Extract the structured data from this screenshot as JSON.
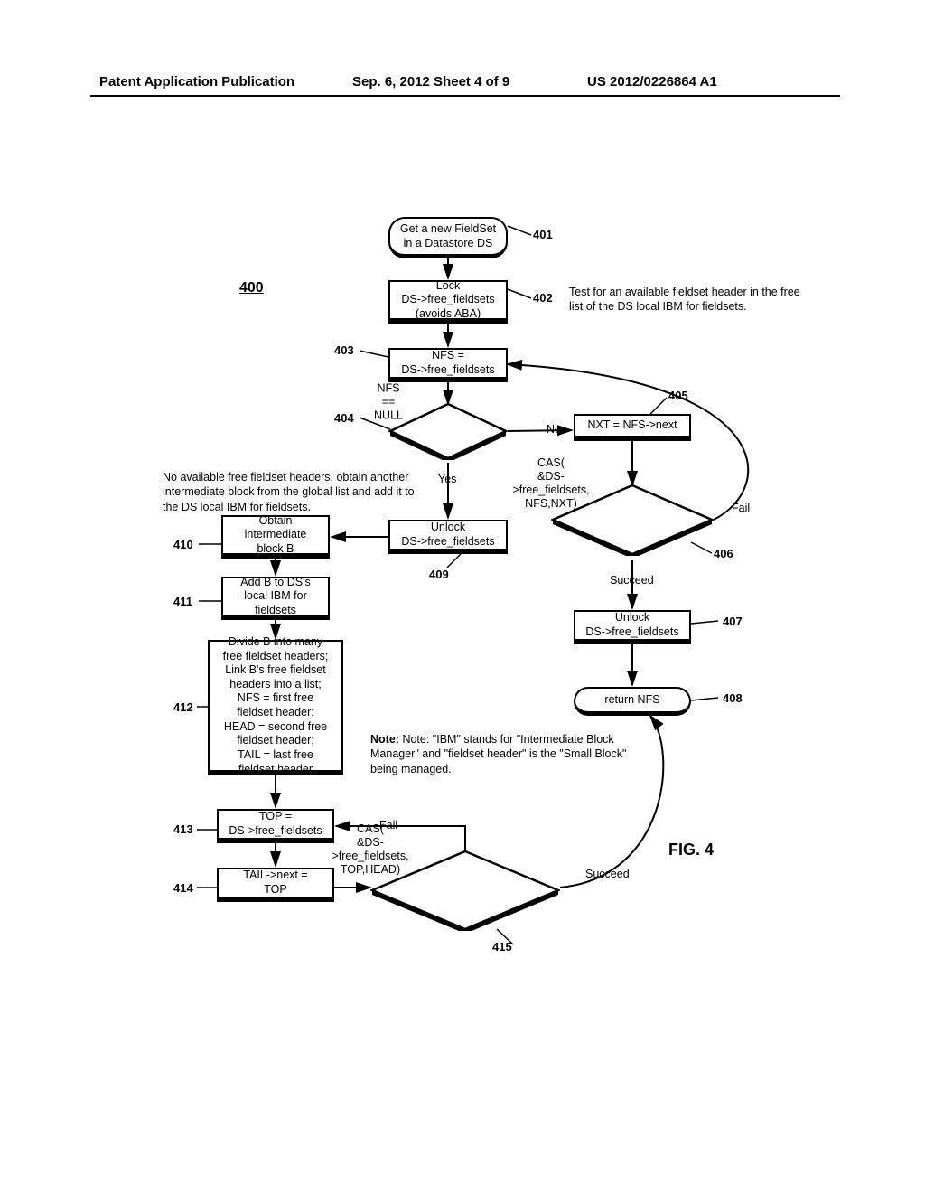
{
  "header": {
    "left": "Patent Application Publication",
    "center": "Sep. 6, 2012  Sheet 4 of 9",
    "right": "US 2012/0226864 A1"
  },
  "figure_ref": "400",
  "figure_label": "FIG. 4",
  "nodes": {
    "n401": "Get a new FieldSet in a Datastore DS",
    "n402": "Lock\nDS->free_fieldsets\n(avoids ABA)",
    "n403": "NFS =\nDS->free_fieldsets",
    "n404": "NFS ==\nNULL",
    "n405": "NXT = NFS->next",
    "n406": "CAS(\n&DS->free_fieldsets,\nNFS,NXT)",
    "n407": "Unlock\nDS->free_fieldsets",
    "n408": "return NFS",
    "n409": "Unlock\nDS->free_fieldsets",
    "n410": "Obtain\nintermediate\nblock B",
    "n411": "Add B to DS's\nlocal IBM for\nfieldsets",
    "n412": "Divide B into many\nfree fieldset headers;\nLink B's free fieldset\nheaders into a list;\nNFS = first free\nfieldset header;\nHEAD = second free\nfieldset header;\nTAIL = last free\nfieldset header",
    "n413": "TOP =\nDS->free_fieldsets",
    "n414": "TAIL->next =\nTOP",
    "n415": "CAS(\n&DS->free_fieldsets,\nTOP,HEAD)"
  },
  "refs": {
    "r401": "401",
    "r402": "402",
    "r403": "403",
    "r404": "404",
    "r405": "405",
    "r406": "406",
    "r407": "407",
    "r408": "408",
    "r409": "409",
    "r410": "410",
    "r411": "411",
    "r412": "412",
    "r413": "413",
    "r414": "414",
    "r415": "415"
  },
  "annotations": {
    "top_right": "Test for an available fieldset header in the free list of the DS local IBM for fieldsets.",
    "mid_left": "No available free fieldset headers, obtain another intermediate block from the global list and add it to the DS local IBM for fieldsets.",
    "note": "Note: \"IBM\" stands for \"Intermediate Block Manager\" and \"fieldset header\" is the \"Small Block\" being managed."
  },
  "edge_labels": {
    "no": "No",
    "yes": "Yes",
    "fail": "Fail",
    "succeed": "Succeed"
  }
}
